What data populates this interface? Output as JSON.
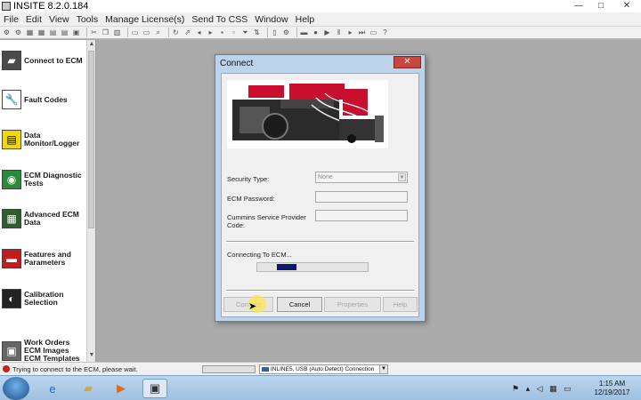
{
  "app": {
    "title": "INSITE 8.2.0.184",
    "window_controls": [
      "—",
      "□",
      "✕"
    ]
  },
  "menu": [
    "File",
    "Edit",
    "View",
    "Tools",
    "Manage License(s)",
    "Send To CSS",
    "Window",
    "Help"
  ],
  "sidebar": {
    "items": [
      {
        "label": "Connect to ECM",
        "icon": "connect-ecm-icon"
      },
      {
        "label": "Fault Codes",
        "icon": "wrench-icon"
      },
      {
        "label": "Data Monitor/Logger",
        "icon": "monitor-icon"
      },
      {
        "label": "ECM Diagnostic Tests",
        "icon": "diagnostic-icon"
      },
      {
        "label": "Advanced ECM Data",
        "icon": "advanced-data-icon"
      },
      {
        "label": "Features and Parameters",
        "icon": "toolbox-icon"
      },
      {
        "label": "Calibration Selection",
        "icon": "calibration-icon"
      },
      {
        "label": "Work Orders ECM Images ECM Templates",
        "icon": "work-orders-icon"
      }
    ]
  },
  "dialog": {
    "title": "Connect",
    "close_glyph": "✕",
    "security_type_label": "Security Type:",
    "security_type_value": "None",
    "ecm_password_label": "ECM Password:",
    "ecm_password_value": "",
    "csp_code_label": "Cummins Service Provider Code:",
    "csp_code_value": "",
    "connecting_text": "Connecting To ECM...",
    "progress_fraction": 0.22,
    "buttons": {
      "connect": "Connect",
      "cancel": "Cancel",
      "properties": "Properties",
      "help": "Help"
    }
  },
  "status": {
    "message": "Trying to connect to the ECM, please wait.",
    "connection": "INLINE5, USB (Auto Detect) Connection"
  },
  "clock": {
    "time": "1:15 AM",
    "date": "12/19/2017"
  },
  "colors": {
    "accent_dialog": "#bcd3ec",
    "progress_block": "#0c1a6e",
    "close_button": "#c9463d",
    "status_error": "#c81e1e"
  }
}
